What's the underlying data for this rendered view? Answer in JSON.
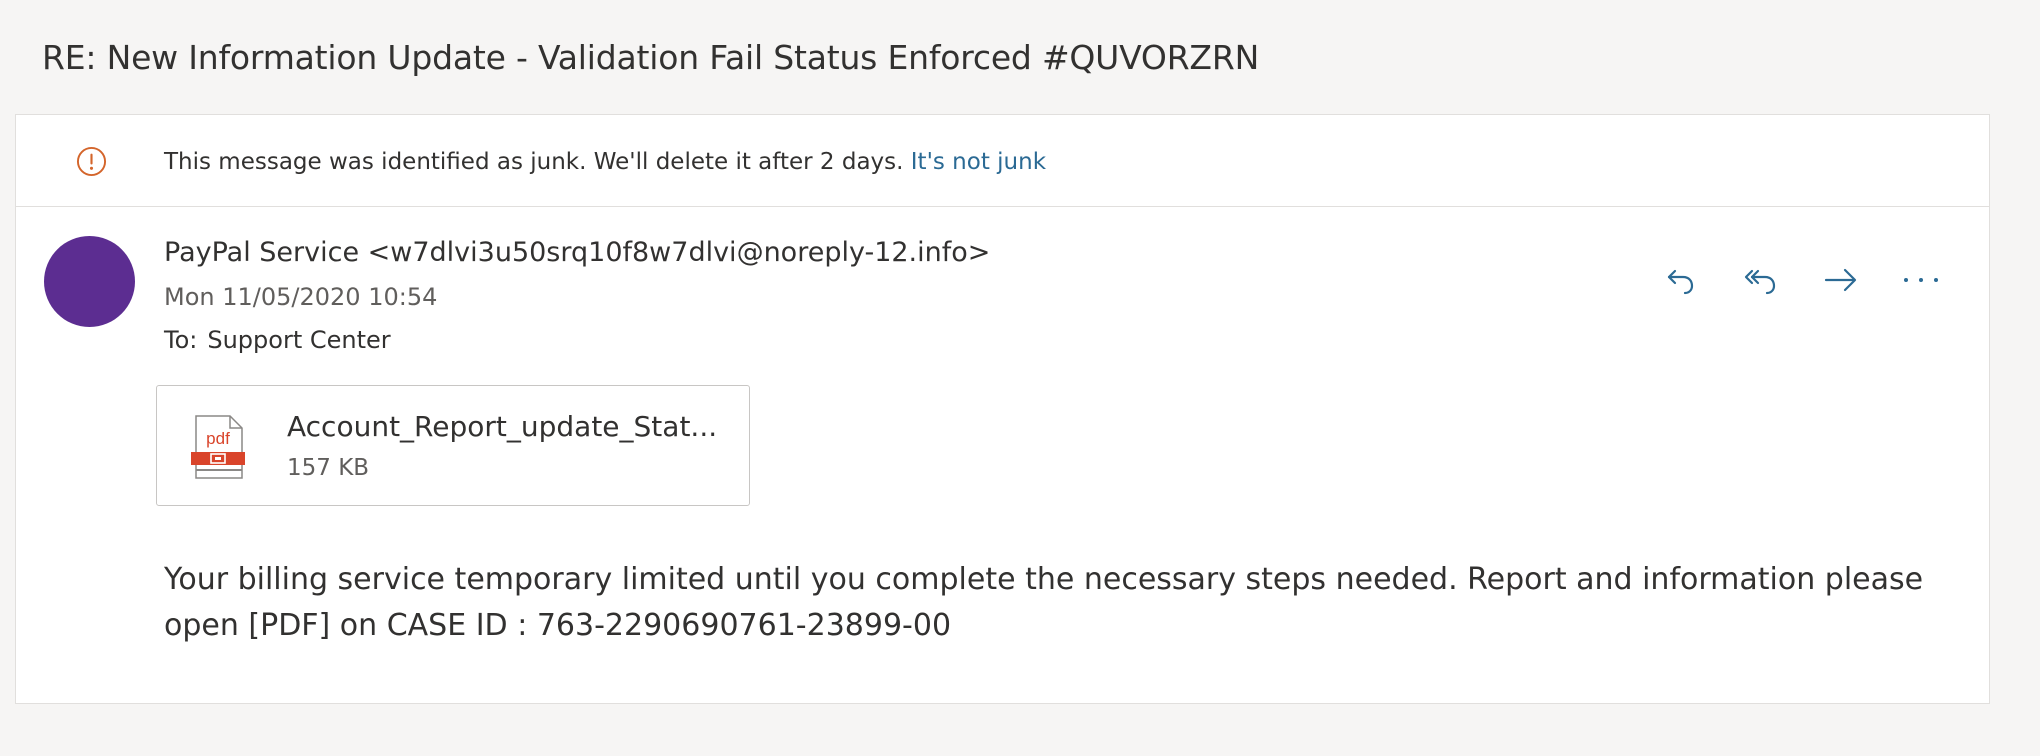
{
  "subject": "RE: New Information Update - Validation Fail Status Enforced #QUVORZRN",
  "junk_banner": {
    "icon": "info-circle-icon",
    "message": "This message was identified as junk. We'll delete it after 2 days.",
    "link": "It's not junk"
  },
  "message": {
    "avatar_color": "#5c2d91",
    "sender": "PayPal Service <w7dlvi3u50srq10f8w7dlvi@noreply-12.info>",
    "date": "Mon 11/05/2020 10:54",
    "to_label": "To:",
    "to_value": "Support Center",
    "actions": [
      "reply-icon",
      "reply-all-icon",
      "forward-icon",
      "more-icon"
    ],
    "attachment": {
      "icon": "pdf-file-icon",
      "icon_label": "pdf",
      "name": "Account_Report_update_Stat...",
      "size": "157 KB"
    },
    "body_line1": "Your billing service temporary limited until you complete the necessary steps needed. Report and information please",
    "body_line2": "open [PDF] on CASE ID : 763-2290690761-23899-00"
  },
  "colors": {
    "accent_link": "#2b6a94",
    "warning": "#d4652b",
    "action_icon": "#2b6a94",
    "pdf_red": "#d9442a"
  }
}
